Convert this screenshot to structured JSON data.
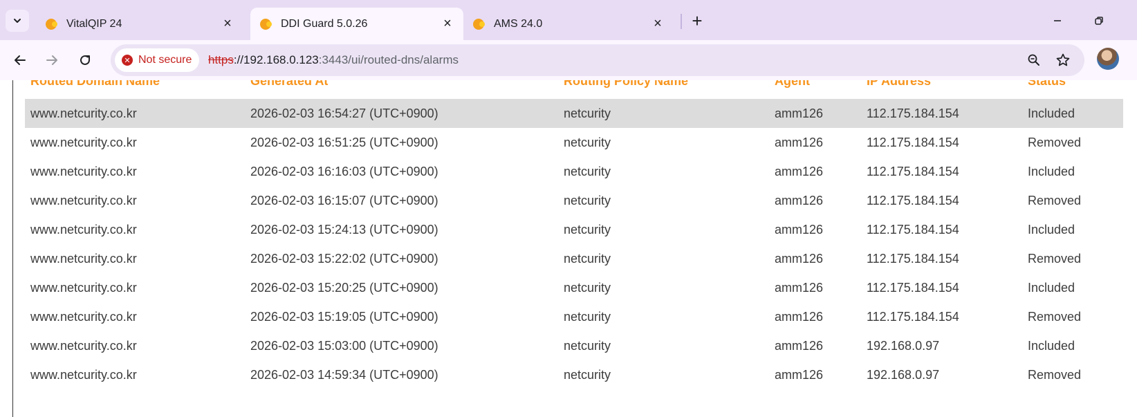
{
  "browser": {
    "tabs": [
      {
        "title": "VitalQIP 24",
        "active": false
      },
      {
        "title": "DDI Guard 5.0.26",
        "active": true
      },
      {
        "title": "AMS 24.0",
        "active": false
      }
    ],
    "security_chip": "Not secure",
    "url": {
      "scheme": "https",
      "host": "://192.168.0.123",
      "rest": ":3443/ui/routed-dns/alarms"
    },
    "colors": {
      "tabstrip": "#e8dcf4",
      "toolbar": "#fbf6ff",
      "warning": "#c5221f"
    }
  },
  "table": {
    "headers": [
      "Routed Domain Name",
      "Generated At",
      "Routing Policy Name",
      "Agent",
      "IP Address",
      "Status"
    ],
    "header_color": "#f7941d",
    "rows": [
      {
        "domain": "www.netcurity.co.kr",
        "generated_at": "2026-02-03 16:54:27 (UTC+0900)",
        "policy": "netcurity",
        "agent": "amm126",
        "ip": "112.175.184.154",
        "status": "Included"
      },
      {
        "domain": "www.netcurity.co.kr",
        "generated_at": "2026-02-03 16:51:25 (UTC+0900)",
        "policy": "netcurity",
        "agent": "amm126",
        "ip": "112.175.184.154",
        "status": "Removed"
      },
      {
        "domain": "www.netcurity.co.kr",
        "generated_at": "2026-02-03 16:16:03 (UTC+0900)",
        "policy": "netcurity",
        "agent": "amm126",
        "ip": "112.175.184.154",
        "status": "Included"
      },
      {
        "domain": "www.netcurity.co.kr",
        "generated_at": "2026-02-03 16:15:07 (UTC+0900)",
        "policy": "netcurity",
        "agent": "amm126",
        "ip": "112.175.184.154",
        "status": "Removed"
      },
      {
        "domain": "www.netcurity.co.kr",
        "generated_at": "2026-02-03 15:24:13 (UTC+0900)",
        "policy": "netcurity",
        "agent": "amm126",
        "ip": "112.175.184.154",
        "status": "Included"
      },
      {
        "domain": "www.netcurity.co.kr",
        "generated_at": "2026-02-03 15:22:02 (UTC+0900)",
        "policy": "netcurity",
        "agent": "amm126",
        "ip": "112.175.184.154",
        "status": "Removed"
      },
      {
        "domain": "www.netcurity.co.kr",
        "generated_at": "2026-02-03 15:20:25 (UTC+0900)",
        "policy": "netcurity",
        "agent": "amm126",
        "ip": "112.175.184.154",
        "status": "Included"
      },
      {
        "domain": "www.netcurity.co.kr",
        "generated_at": "2026-02-03 15:19:05 (UTC+0900)",
        "policy": "netcurity",
        "agent": "amm126",
        "ip": "112.175.184.154",
        "status": "Removed"
      },
      {
        "domain": "www.netcurity.co.kr",
        "generated_at": "2026-02-03 15:03:00 (UTC+0900)",
        "policy": "netcurity",
        "agent": "amm126",
        "ip": "192.168.0.97",
        "status": "Included"
      },
      {
        "domain": "www.netcurity.co.kr",
        "generated_at": "2026-02-03 14:59:34 (UTC+0900)",
        "policy": "netcurity",
        "agent": "amm126",
        "ip": "192.168.0.97",
        "status": "Removed"
      }
    ],
    "selected_row": 0
  }
}
